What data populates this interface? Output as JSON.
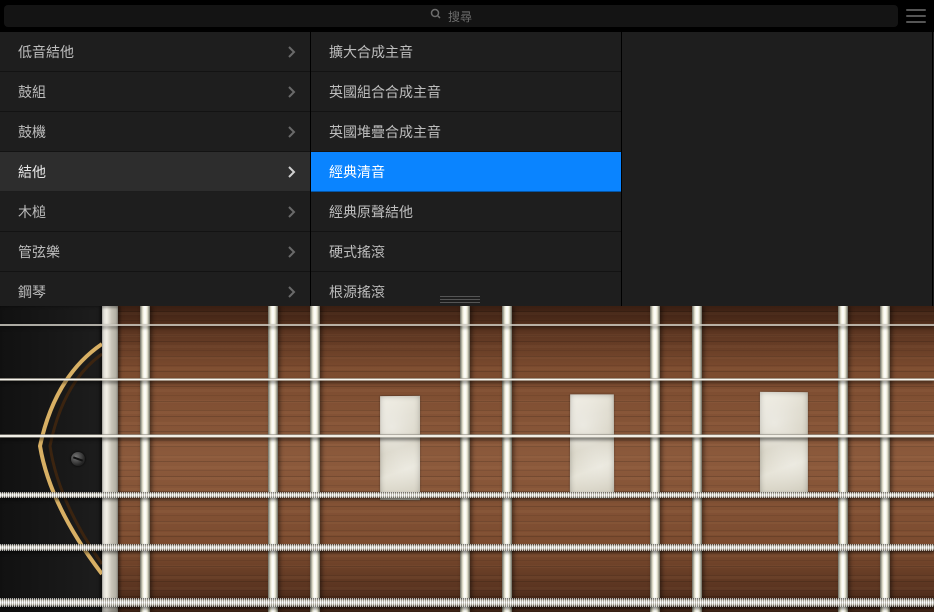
{
  "search": {
    "placeholder": "搜尋"
  },
  "menu": {
    "categories": [
      {
        "label": "低音結他"
      },
      {
        "label": "鼓組"
      },
      {
        "label": "鼓機"
      },
      {
        "label": "結他",
        "active": true
      },
      {
        "label": "木槌"
      },
      {
        "label": "管弦樂"
      },
      {
        "label": "鋼琴"
      }
    ],
    "presets": [
      {
        "label": "擴大合成主音"
      },
      {
        "label": "英國組合合成主音"
      },
      {
        "label": "英國堆疊合成主音"
      },
      {
        "label": "經典清音",
        "selected": true
      },
      {
        "label": "經典原聲結他"
      },
      {
        "label": "硬式搖滾"
      },
      {
        "label": "根源搖滾"
      }
    ]
  },
  "instrument": {
    "type": "guitar",
    "preset": "經典清音",
    "string_count": 6
  }
}
